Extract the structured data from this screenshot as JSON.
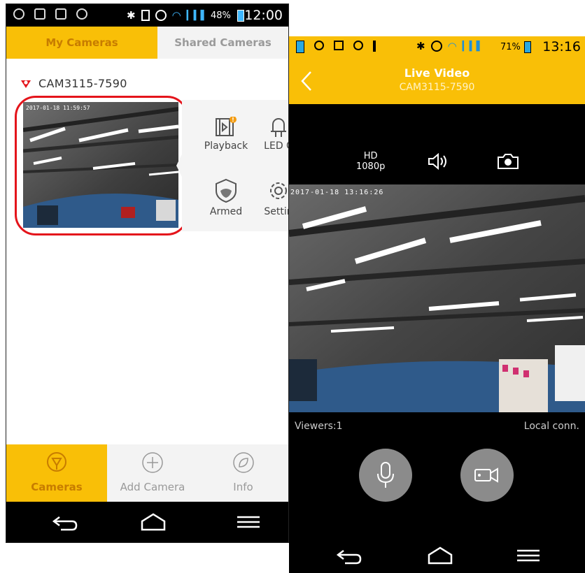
{
  "left_phone": {
    "status_bar": {
      "battery_percent": "48%",
      "time": "12:00"
    },
    "tabs": [
      "My Cameras",
      "Shared Cameras"
    ],
    "camera": {
      "name": "CAM3115-7590",
      "thumbnail_timestamp": "2017-01-18 11:59:57"
    },
    "actions": [
      {
        "label": "Playback",
        "icon": "playback-film-icon",
        "badge": "!"
      },
      {
        "label": "LED C",
        "icon": "led-bulb-icon"
      },
      {
        "label": "Armed",
        "icon": "shield-icon"
      },
      {
        "label": "Settin",
        "icon": "gear-icon"
      }
    ],
    "bottom_nav": [
      {
        "label": "Cameras",
        "icon": "camera-pin-icon",
        "active": true
      },
      {
        "label": "Add Camera",
        "icon": "plus-circle-icon",
        "active": false
      },
      {
        "label": "Info",
        "icon": "info-leaf-icon",
        "active": false
      }
    ]
  },
  "right_phone": {
    "status_bar": {
      "battery_percent": "71%",
      "time": "13:16"
    },
    "header": {
      "title": "Live Video",
      "subtitle": "CAM3115-7590"
    },
    "toolbar": {
      "quality_line1": "HD",
      "quality_line2": "1080p"
    },
    "video_timestamp": "2017-01-18 13:16:26",
    "viewers": "Viewers:1",
    "connection": "Local conn."
  },
  "colors": {
    "accent": "#f9bf07",
    "highlight": "#e4141b",
    "inactive_tab_text": "#9a9a9a"
  }
}
